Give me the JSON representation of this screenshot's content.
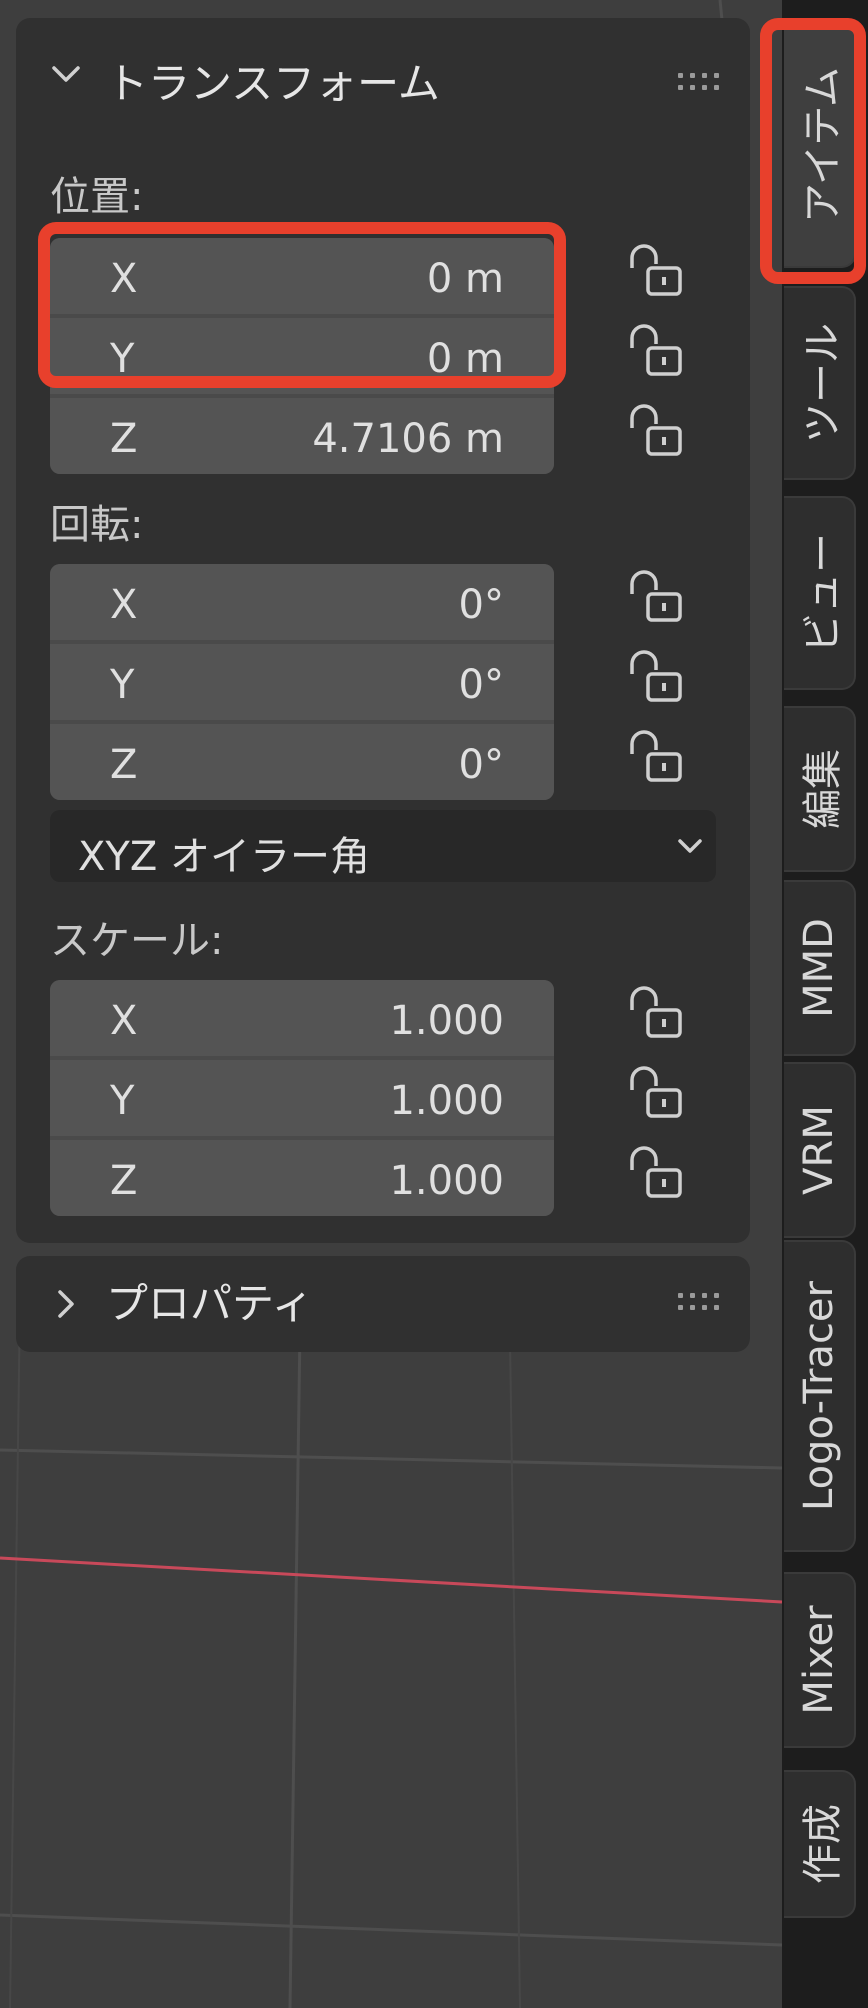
{
  "transform_panel": {
    "title": "トランスフォーム",
    "location": {
      "label": "位置:",
      "fields": [
        {
          "axis": "X",
          "value": "0 m"
        },
        {
          "axis": "Y",
          "value": "0 m"
        },
        {
          "axis": "Z",
          "value": "4.7106 m"
        }
      ]
    },
    "rotation": {
      "label": "回転:",
      "fields": [
        {
          "axis": "X",
          "value": "0°"
        },
        {
          "axis": "Y",
          "value": "0°"
        },
        {
          "axis": "Z",
          "value": "0°"
        }
      ],
      "mode": "XYZ オイラー角"
    },
    "scale": {
      "label": "スケール:",
      "fields": [
        {
          "axis": "X",
          "value": "1.000"
        },
        {
          "axis": "Y",
          "value": "1.000"
        },
        {
          "axis": "Z",
          "value": "1.000"
        }
      ]
    }
  },
  "properties_panel": {
    "title": "プロパティ"
  },
  "tabs": [
    {
      "label": "アイテム",
      "active": true
    },
    {
      "label": "ツール"
    },
    {
      "label": "ビュー"
    },
    {
      "label": "編集"
    },
    {
      "label": "MMD"
    },
    {
      "label": "VRM"
    },
    {
      "label": "Logo-Tracer"
    },
    {
      "label": "Mixer"
    },
    {
      "label": "作成"
    }
  ],
  "colors": {
    "highlight": "#e8402c",
    "x_axis_line": "#c8495a"
  }
}
